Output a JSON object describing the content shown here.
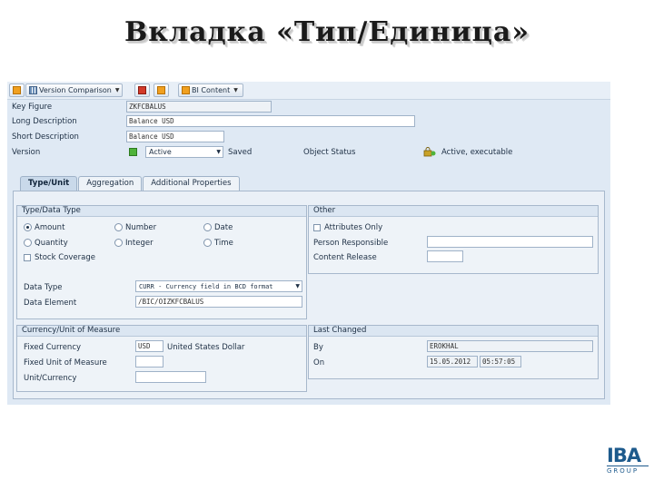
{
  "slide": {
    "title": "Вкладка «Тип/Единица»"
  },
  "toolbar": {
    "version_comparison": "Version Comparison",
    "bi_content": "BI Content"
  },
  "header": {
    "key_figure_label": "Key Figure",
    "key_figure_value": "ZKFCBALUS",
    "long_desc_label": "Long Description",
    "long_desc_value": "Balance USD",
    "short_desc_label": "Short Description",
    "short_desc_value": "Balance USD",
    "version_label": "Version",
    "version_value": "Active",
    "version_status": "Saved",
    "object_status_label": "Object Status",
    "object_status_value": "Active, executable"
  },
  "tabs": [
    "Type/Unit",
    "Aggregation",
    "Additional Properties"
  ],
  "type_group": {
    "title": "Type/Data Type",
    "radios": [
      {
        "label": "Amount",
        "selected": true
      },
      {
        "label": "Number",
        "selected": false
      },
      {
        "label": "Date",
        "selected": false
      },
      {
        "label": "Quantity",
        "selected": false
      },
      {
        "label": "Integer",
        "selected": false
      },
      {
        "label": "Time",
        "selected": false
      }
    ],
    "stock_coverage": "Stock Coverage",
    "data_type_label": "Data Type",
    "data_type_value": "CURR - Currency field in BCD format",
    "data_element_label": "Data Element",
    "data_element_value": "/BIC/OIZKFCBALUS"
  },
  "other_group": {
    "title": "Other",
    "attributes_only": "Attributes Only",
    "person_responsible_label": "Person Responsible",
    "content_release_label": "Content Release"
  },
  "currency_group": {
    "title": "Currency/Unit of Measure",
    "fixed_currency_label": "Fixed Currency",
    "fixed_currency_value": "USD",
    "fixed_currency_text": "United States Dollar",
    "fixed_unit_label": "Fixed Unit of Measure",
    "unit_currency_label": "Unit/Currency"
  },
  "last_changed_group": {
    "title": "Last Changed",
    "by_label": "By",
    "by_value": "EROKHAL",
    "on_label": "On",
    "on_date": "15.05.2012",
    "on_time": "05:57:05"
  },
  "logo": {
    "main": "IBA",
    "sub": "GROUP"
  },
  "colors": {
    "panel": "#dfe9f4",
    "logo": "#1d5a8c",
    "active_dot": "#4fb33a"
  }
}
